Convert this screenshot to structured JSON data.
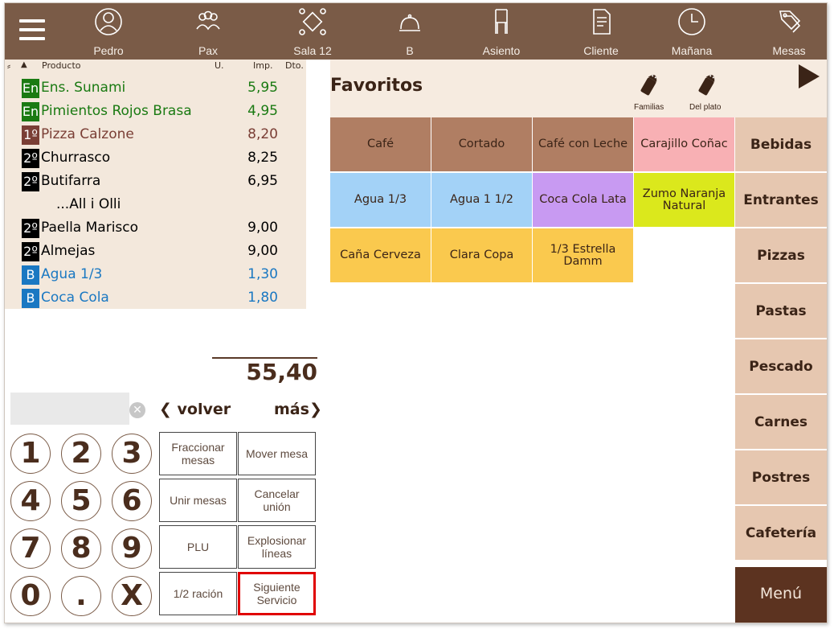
{
  "header": {
    "nav": [
      {
        "label": "Pedro",
        "icon": "user-icon"
      },
      {
        "label": "Pax",
        "icon": "group-icon"
      },
      {
        "label": "Sala 12",
        "icon": "room-icon"
      },
      {
        "label": "B",
        "icon": "cloche-icon"
      },
      {
        "label": "Asiento",
        "icon": "chair-icon"
      },
      {
        "label": "Cliente",
        "icon": "document-icon"
      },
      {
        "label": "Mañana",
        "icon": "clock-icon"
      },
      {
        "label": "Mesas",
        "icon": "tags-icon"
      }
    ]
  },
  "ticket": {
    "columns": {
      "producto": "Producto",
      "units": "U.",
      "importe": "Imp.",
      "discount": "Dto."
    },
    "rows": [
      {
        "tag": "En",
        "name": "Ens. Sunami",
        "amount": "5,95",
        "tag_color": "#1a7a12",
        "text_color": "#1a7a12"
      },
      {
        "tag": "En",
        "name": "Pimientos Rojos Brasa",
        "amount": "4,95",
        "tag_color": "#1a7a12",
        "text_color": "#1a7a12"
      },
      {
        "tag": "1º",
        "name": "Pizza Calzone",
        "amount": "8,20",
        "tag_color": "#7a3e35",
        "text_color": "#7a3e35"
      },
      {
        "tag": "2º",
        "name": "Churrasco",
        "amount": "8,25",
        "tag_color": "#000000",
        "text_color": "#000000"
      },
      {
        "tag": "2º",
        "name": "Butifarra",
        "amount": "6,95",
        "tag_color": "#000000",
        "text_color": "#000000"
      },
      {
        "tag": "",
        "name": "...All i Olli",
        "amount": "",
        "tag_color": "",
        "text_color": "#000000"
      },
      {
        "tag": "2º",
        "name": "Paella Marisco",
        "amount": "9,00",
        "tag_color": "#000000",
        "text_color": "#000000"
      },
      {
        "tag": "2º",
        "name": "Almejas",
        "amount": "9,00",
        "tag_color": "#000000",
        "text_color": "#000000"
      },
      {
        "tag": "B",
        "name": "Agua 1/3",
        "amount": "1,30",
        "tag_color": "#1a78c2",
        "text_color": "#1a78c2"
      },
      {
        "tag": "B",
        "name": "Coca Cola",
        "amount": "1,80",
        "tag_color": "#1a78c2",
        "text_color": "#1a78c2"
      }
    ],
    "total": "55,40"
  },
  "keypad": {
    "keys": [
      "1",
      "2",
      "3",
      "4",
      "5",
      "6",
      "7",
      "8",
      "9",
      "0",
      ".",
      "X"
    ],
    "clear_icon": "clear-icon"
  },
  "nav_buttons": {
    "back": "volver",
    "more": "más"
  },
  "actions": [
    {
      "label": "Fraccionar mesas"
    },
    {
      "label": "Mover mesa"
    },
    {
      "label": "Unir mesas"
    },
    {
      "label": "Cancelar unión"
    },
    {
      "label": "PLU"
    },
    {
      "label": "Explosionar líneas"
    },
    {
      "label": "1/2 ración"
    },
    {
      "label": "Siguiente Servicio",
      "highlight_color": "#e00000"
    }
  ],
  "favorites": {
    "title": "Favoritos",
    "tools": [
      {
        "label": "Familias",
        "icon": "salt-shaker-icon"
      },
      {
        "label": "Del plato",
        "icon": "salt-shaker-icon"
      }
    ],
    "products": [
      {
        "label": "Café",
        "color": "#b07e63"
      },
      {
        "label": "Cortado",
        "color": "#b07e63"
      },
      {
        "label": "Café con Leche",
        "color": "#b07e63"
      },
      {
        "label": "Carajillo Coñac",
        "color": "#f8b0b4"
      },
      {
        "label": "Agua 1/3",
        "color": "#a3d2f7"
      },
      {
        "label": "Agua 1 1/2",
        "color": "#a3d2f7"
      },
      {
        "label": "Coca Cola Lata",
        "color": "#c89af2"
      },
      {
        "label": "Zumo Naranja Natural",
        "color": "#dbe81c"
      },
      {
        "label": "Caña Cerveza",
        "color": "#fac94e"
      },
      {
        "label": "Clara Copa",
        "color": "#fac94e"
      },
      {
        "label": "1/3 Estrella Damm",
        "color": "#fac94e"
      }
    ]
  },
  "categories": [
    "Bebidas",
    "Entrantes",
    "Pizzas",
    "Pastas",
    "Pescado",
    "Carnes",
    "Postres",
    "Cafetería"
  ],
  "menu_label": "Menú"
}
